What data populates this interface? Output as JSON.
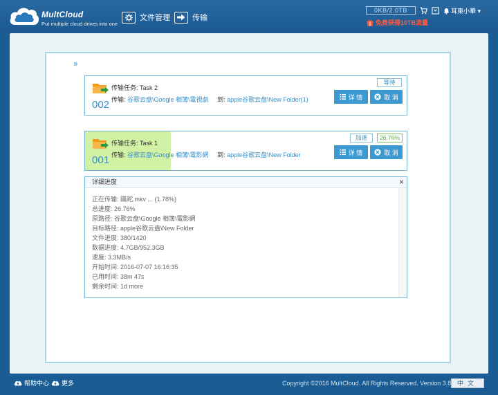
{
  "header": {
    "logo_name": "MultCloud",
    "logo_tagline": "Put multiple cloud drives into one",
    "nav": [
      {
        "label": "文件管理",
        "icon": "gear-icon"
      },
      {
        "label": "传输",
        "icon": "transfer-arrow-icon"
      }
    ],
    "quota": "0KB/2.0TB",
    "username": "耳東小華",
    "gift_text": "免费获得10TB流量"
  },
  "tasks": [
    {
      "title": "传输任务: Task 2",
      "number": "002",
      "path_prefix": "传输:",
      "source": "谷歌云盘\\Google 相簿\\電視劇",
      "to_label": "到:",
      "destination": "apple谷歌云盘\\New Folder(1)",
      "status": "等待",
      "progress_pct": 0,
      "detail_label": "详 情",
      "cancel_label": "取 消"
    },
    {
      "title": "传输任务: Task 1",
      "number": "001",
      "path_prefix": "传输:",
      "source": "谷歌云盘\\Google 相簿\\電影網",
      "to_label": "到:",
      "destination": "apple谷歌云盘\\New Folder",
      "speed_badge": "加速",
      "progress_label": "26.76%",
      "progress_pct": 26.76,
      "detail_label": "详 情",
      "cancel_label": "取 消"
    }
  ],
  "details": {
    "title": "详细进度",
    "close": "×",
    "lines": [
      "正在传输: 蹣跎.mkv ... (1.78%)",
      "总进度: 26.76%",
      "原路径: 谷歌云盘\\Google 相簿\\電影網",
      "目标路径: apple谷歌云盘\\New Folder",
      "文件进度: 380/1420",
      "数据进度: 4.7GB/952.3GB",
      "速度: 3.3MB/s",
      "开始时间: 2016-07-07 16:16:35",
      "已用时间: 38m 47s",
      "剩余时间: 1d more"
    ]
  },
  "footer": {
    "help": "帮助中心",
    "more": "更多",
    "copyright": "Copyright ©2016 MultCloud. All Rights Reserved. Version 3.8.0",
    "language": "中文"
  },
  "colors": {
    "brand_blue": "#1b5c94",
    "button_blue": "#3c9ad2",
    "progress_green": "#d1f2a5",
    "gift_red": "#ff5a3a"
  }
}
